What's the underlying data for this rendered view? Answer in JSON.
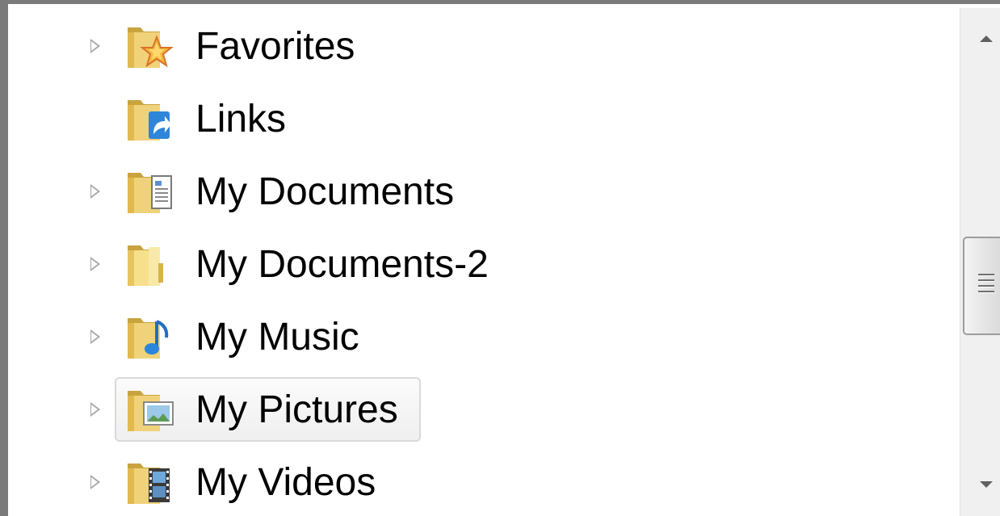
{
  "tree": {
    "items": [
      {
        "label": "Favorites",
        "icon": "favorites-folder-icon",
        "has_children": true,
        "selected": false
      },
      {
        "label": "Links",
        "icon": "links-folder-icon",
        "has_children": false,
        "selected": false
      },
      {
        "label": "My Documents",
        "icon": "documents-folder-icon",
        "has_children": true,
        "selected": false
      },
      {
        "label": "My Documents-2",
        "icon": "plain-folder-icon",
        "has_children": true,
        "selected": false
      },
      {
        "label": "My Music",
        "icon": "music-folder-icon",
        "has_children": true,
        "selected": false
      },
      {
        "label": "My Pictures",
        "icon": "pictures-folder-icon",
        "has_children": true,
        "selected": true
      },
      {
        "label": "My Videos",
        "icon": "videos-folder-icon",
        "has_children": true,
        "selected": false
      }
    ]
  },
  "colors": {
    "folder": "#e9c86a",
    "folder_dark": "#c9a33e",
    "selection_border": "#d9d9d9",
    "scrollbar_track": "#f0f0f0"
  }
}
